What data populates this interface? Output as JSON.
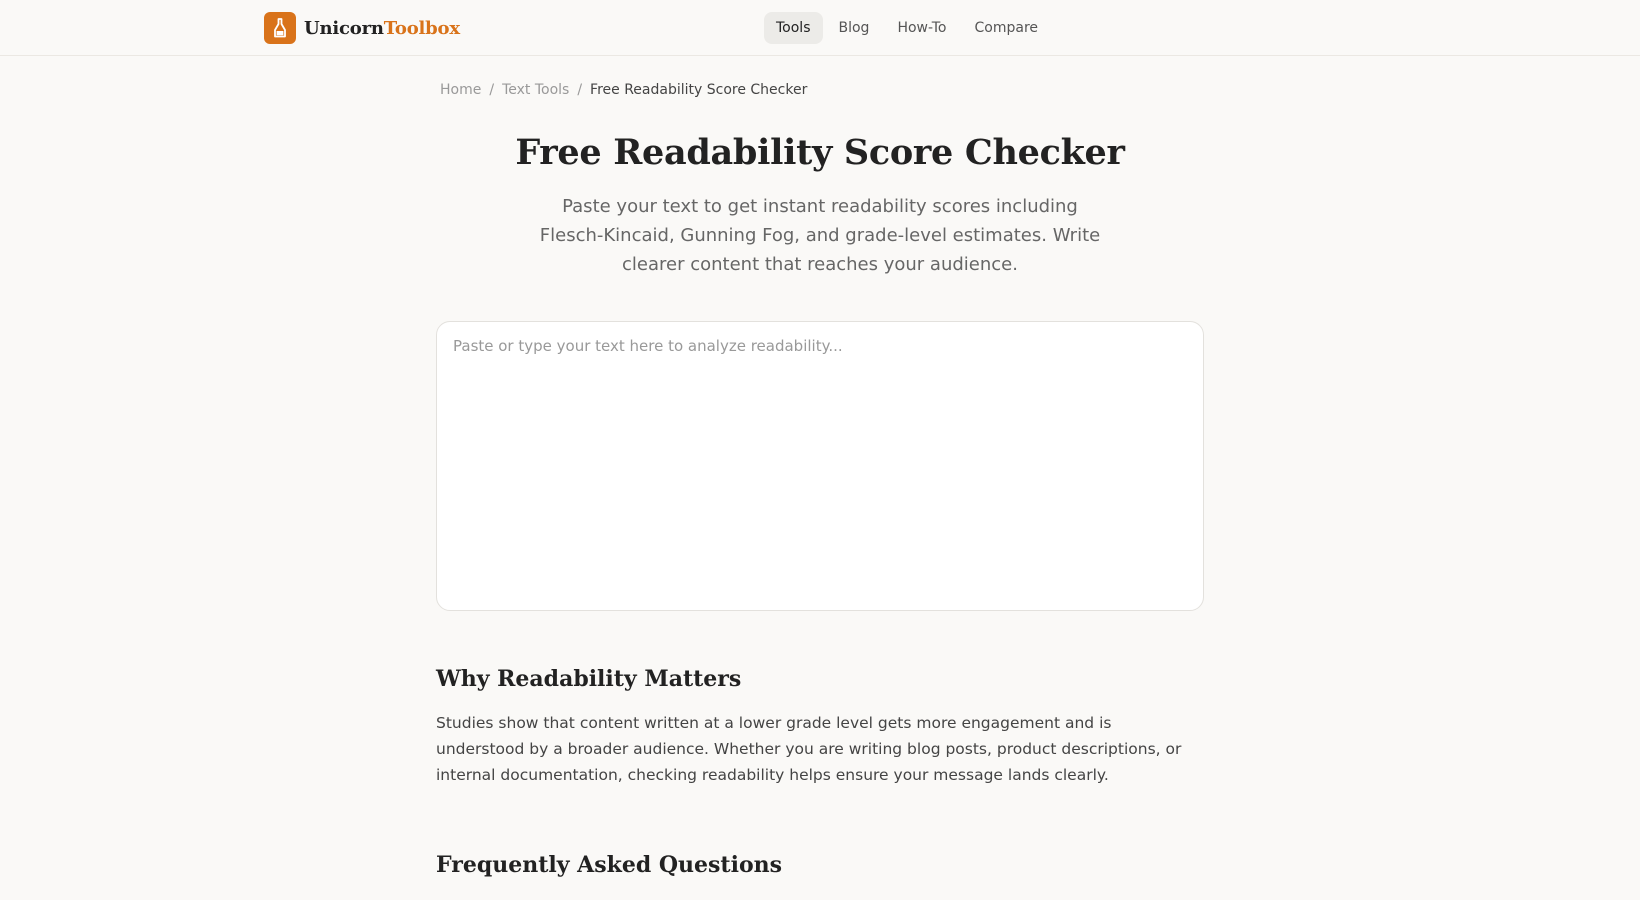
{
  "brand": {
    "name_part1": "Unicorn",
    "name_part2": "Toolbox",
    "icon": "bottle-icon",
    "accent_color": "#d9731a"
  },
  "nav": {
    "items": [
      {
        "label": "Tools",
        "active": true
      },
      {
        "label": "Blog",
        "active": false
      },
      {
        "label": "How-To",
        "active": false
      },
      {
        "label": "Compare",
        "active": false
      }
    ]
  },
  "breadcrumb": {
    "items": [
      "Home",
      "Text Tools"
    ],
    "current": "Free Readability Score Checker",
    "separator": "/"
  },
  "hero": {
    "title": "Free Readability Score Checker",
    "subtitle": "Paste your text to get instant readability scores including Flesch-Kincaid, Gunning Fog, and grade-level estimates. Write clearer content that reaches your audience."
  },
  "editor": {
    "value": "",
    "placeholder": "Paste or type your text here to analyze readability..."
  },
  "sections": {
    "why": {
      "title": "Why Readability Matters",
      "body": "Studies show that content written at a lower grade level gets more engagement and is understood by a broader audience. Whether you are writing blog posts, product descriptions, or internal documentation, checking readability helps ensure your message lands clearly."
    },
    "faq": {
      "title": "Frequently Asked Questions"
    }
  }
}
